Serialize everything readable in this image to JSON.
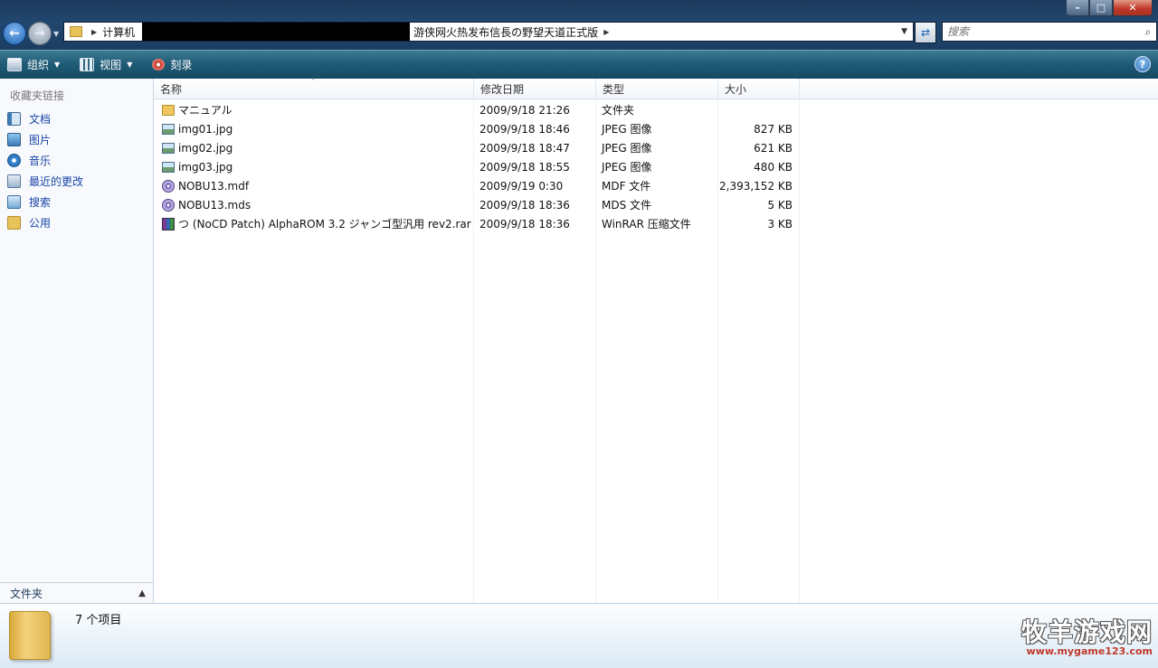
{
  "window": {
    "minimize": "–",
    "maximize": "□",
    "close": "✕"
  },
  "address": {
    "crumb1": "计算机",
    "crumb2": "游侠网火热发布信長の野望天道正式版"
  },
  "search": {
    "placeholder": "搜索"
  },
  "toolbar": {
    "organize": "组织",
    "views": "视图",
    "burn": "刻录"
  },
  "navpane": {
    "favorites_title": "收藏夹链接",
    "links": [
      "文档",
      "图片",
      "音乐",
      "最近的更改",
      "搜索",
      "公用"
    ],
    "folders_label": "文件夹"
  },
  "columns": {
    "name": "名称",
    "date": "修改日期",
    "type": "类型",
    "size": "大小"
  },
  "files": [
    {
      "name": "マニュアル",
      "date": "2009/9/18 21:26",
      "type": "文件夹",
      "size": "",
      "icon": "folder-icon"
    },
    {
      "name": "img01.jpg",
      "date": "2009/9/18 18:46",
      "type": "JPEG 图像",
      "size": "827 KB",
      "icon": "image-icon"
    },
    {
      "name": "img02.jpg",
      "date": "2009/9/18 18:47",
      "type": "JPEG 图像",
      "size": "621 KB",
      "icon": "image-icon"
    },
    {
      "name": "img03.jpg",
      "date": "2009/9/18 18:55",
      "type": "JPEG 图像",
      "size": "480 KB",
      "icon": "image-icon"
    },
    {
      "name": "NOBU13.mdf",
      "date": "2009/9/19 0:30",
      "type": "MDF 文件",
      "size": "2,393,152 KB",
      "icon": "disc-image-icon"
    },
    {
      "name": "NOBU13.mds",
      "date": "2009/9/18 18:36",
      "type": "MDS 文件",
      "size": "5 KB",
      "icon": "disc-image-icon"
    },
    {
      "name": "つ (NoCD Patch) AlphaROM 3.2 ジャンゴ型汎用 rev2.rar",
      "date": "2009/9/18 18:36",
      "type": "WinRAR 压缩文件",
      "size": "3 KB",
      "icon": "rar-archive-icon"
    }
  ],
  "details": {
    "item_count": "7 个项目"
  },
  "watermark": {
    "main": "牧羊游戏网",
    "url": "www.mygame123.com"
  }
}
